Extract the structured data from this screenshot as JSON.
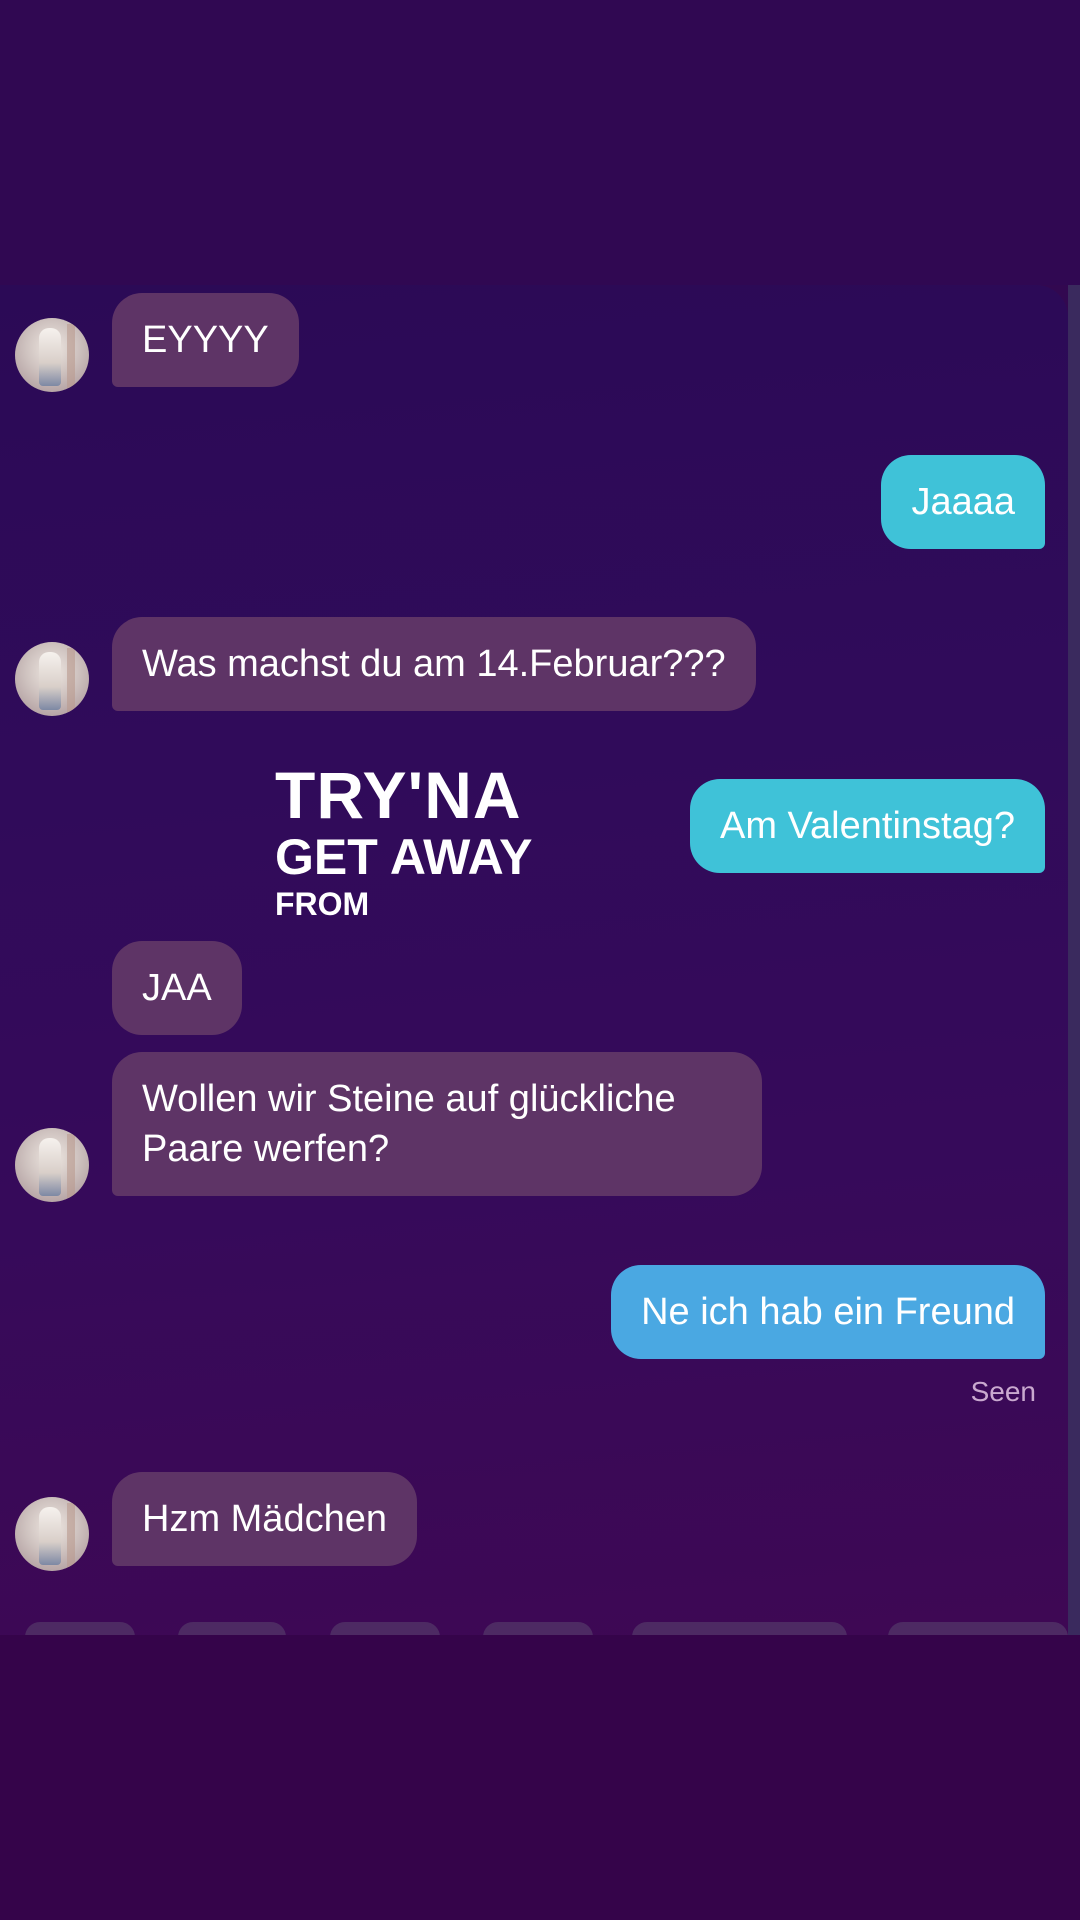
{
  "messages": [
    {
      "id": "m1",
      "side": "in",
      "text": "EYYYY"
    },
    {
      "id": "m2",
      "side": "out",
      "text": "Jaaaa"
    },
    {
      "id": "m3",
      "side": "in",
      "text": "Was machst du am 14.Februar???"
    },
    {
      "id": "m4",
      "side": "out",
      "text": "Am Valentinstag?"
    },
    {
      "id": "m5",
      "side": "in",
      "text": "JAA"
    },
    {
      "id": "m6",
      "side": "in",
      "text": "Wollen wir Steine auf glückliche Paare werfen?"
    },
    {
      "id": "m7",
      "side": "out",
      "text": "Ne ich hab ein Freund"
    },
    {
      "id": "m8",
      "side": "in",
      "text": "Hzm Mädchen"
    }
  ],
  "status": {
    "seen": "Seen"
  },
  "overlay": {
    "line1": "TRY'NA",
    "line2": "GET AWAY",
    "line3": "FROM"
  },
  "colors": {
    "incoming_bubble": "#5e3466",
    "outgoing_bubble": "#3fc2d8",
    "background": "#320850"
  },
  "icons": {
    "avatar": "profile-photo"
  }
}
